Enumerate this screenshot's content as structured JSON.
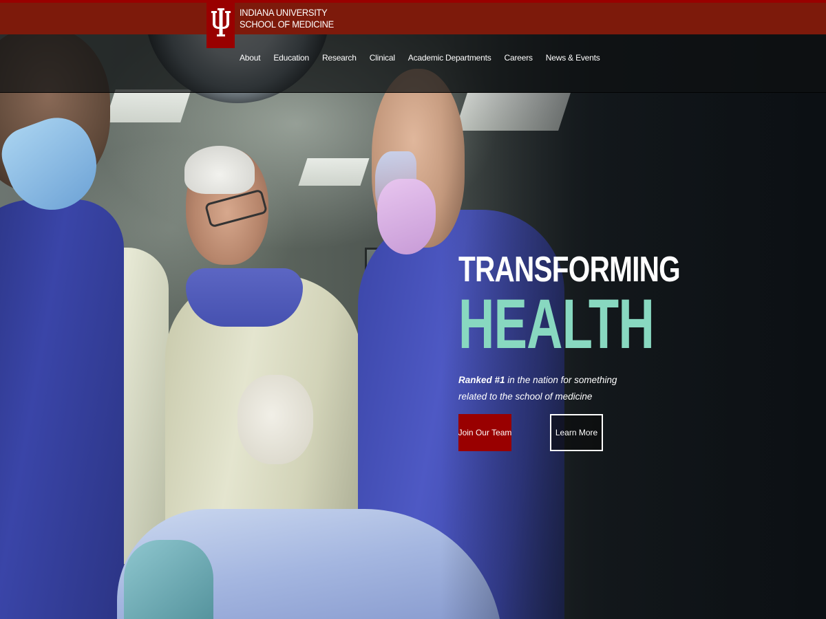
{
  "header": {
    "logo_icon": "iu-trident-icon",
    "logo_line1": "INDIANA UNIVERSITY",
    "logo_line2": "SCHOOL OF MEDICINE",
    "brand_color": "#990000"
  },
  "nav": {
    "items": [
      {
        "label": "About"
      },
      {
        "label": "Education"
      },
      {
        "label": "Research"
      },
      {
        "label": "Clinical"
      },
      {
        "label": "Academic Departments"
      },
      {
        "label": "Careers"
      },
      {
        "label": "News & Events"
      }
    ]
  },
  "hero": {
    "headline_line1": "TRANSFORMING",
    "headline_line2": "HEALTH",
    "headline_accent_color": "#88d8c0",
    "tagline_strong": "Ranked #1",
    "tagline_rest": " in the nation for something related to the school of medicine",
    "cta_primary": "Join Our Team",
    "cta_secondary": "Learn More"
  }
}
